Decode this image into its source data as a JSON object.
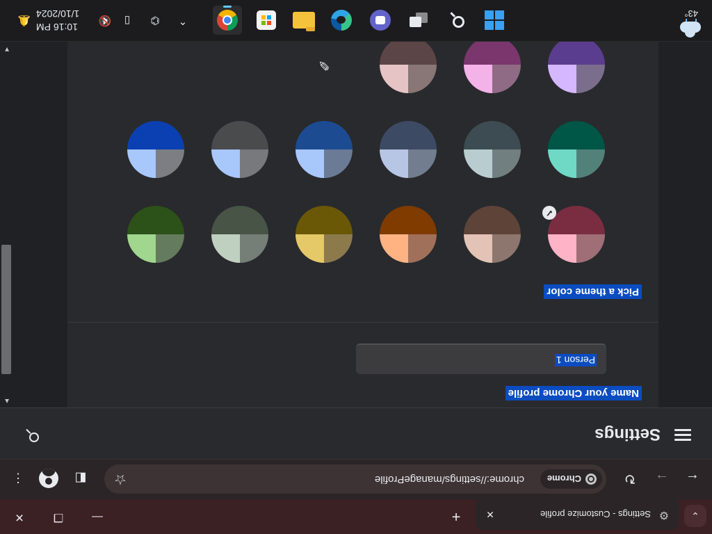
{
  "browser": {
    "tab_title": "Settings - Customize profile",
    "url": "chrome://settings/manageProfile",
    "chip_label": "Chrome"
  },
  "settings": {
    "title": "Settings",
    "name_section_label": "Name your Chrome profile",
    "profile_name_value": "Person 1",
    "theme_section_label": "Pick a theme color",
    "selected_theme_index": 0,
    "themes": [
      {
        "name": "Pink",
        "light": "#ffb3c6",
        "mid": "#9f6e77",
        "dark": "#7a2d41"
      },
      {
        "name": "Brown",
        "light": "#e2c3b5",
        "mid": "#8d766d",
        "dark": "#5e4338"
      },
      {
        "name": "Orange",
        "light": "#ffb383",
        "mid": "#a0705a",
        "dark": "#7f3b00"
      },
      {
        "name": "Yellow",
        "light": "#e5c867",
        "mid": "#8c7a4d",
        "dark": "#6a5806"
      },
      {
        "name": "Sage",
        "light": "#bfd0c0",
        "mid": "#767f77",
        "dark": "#475446"
      },
      {
        "name": "Green",
        "light": "#a0d68e",
        "mid": "#647b5d",
        "dark": "#2c5119"
      },
      {
        "name": "Teal",
        "light": "#6fd9c6",
        "mid": "#52817a",
        "dark": "#005647"
      },
      {
        "name": "Slate",
        "light": "#b9cdd0",
        "mid": "#727f81",
        "dark": "#3d4c52"
      },
      {
        "name": "Steel",
        "light": "#b7c6e5",
        "mid": "#727d8f",
        "dark": "#3d4a63"
      },
      {
        "name": "Blue",
        "light": "#a8c7fa",
        "mid": "#6b7b96",
        "dark": "#1d4b92"
      },
      {
        "name": "Grey",
        "light": "#a8c7fa",
        "mid": "#77797c",
        "dark": "#4a4b4d"
      },
      {
        "name": "Default",
        "light": "#a8c7fa",
        "mid": "#7c7e83",
        "dark": "#0b40b2"
      },
      {
        "name": "Violet",
        "light": "#d5b7ff",
        "mid": "#7b6e8d",
        "dark": "#5b3d8f"
      },
      {
        "name": "Magenta",
        "light": "#f3b2e8",
        "mid": "#8f6b86",
        "dark": "#7b366d"
      },
      {
        "name": "Rose",
        "light": "#e6c3c4",
        "mid": "#897676",
        "dark": "#5c4547"
      }
    ],
    "eyedropper_icon": "eyedropper-icon"
  },
  "taskbar": {
    "time": "10:16 PM",
    "date": "1/10/2024",
    "temperature": "43°",
    "apps": [
      "windows-start",
      "search",
      "task-view",
      "teams-chat",
      "edge",
      "file-explorer",
      "microsoft-store",
      "chrome"
    ]
  }
}
